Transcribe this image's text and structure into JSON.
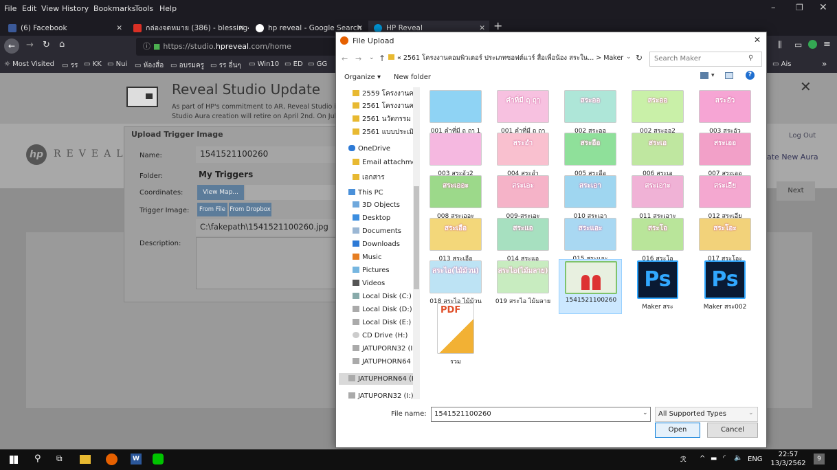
{
  "menubar": {
    "items": [
      "File",
      "Edit",
      "View",
      "History",
      "Bookmarks",
      "Tools",
      "Help"
    ]
  },
  "tabs": [
    {
      "label": "(6) Facebook"
    },
    {
      "label": "กล่องจดหมาย (386) - blessing4"
    },
    {
      "label": "hp reveal - Google Search"
    },
    {
      "label": "HP Reveal"
    }
  ],
  "url": {
    "prefix": "https://studio.",
    "host": "hpreveal",
    "suffix": ".com/home"
  },
  "bookmarks": [
    "Most Visited",
    "รร",
    "KK",
    "Nui",
    "ห้องสื่อ",
    "อบรมครู",
    "รร อื่นๆ",
    "Win10",
    "ED",
    "GG",
    "Ais"
  ],
  "banner": {
    "title": "Reveal Studio Update",
    "line1": "As part of HP's commitment to AR, Reveal Studio is b",
    "line2": "Studio Aura creation will retire on April 2nd. On July 1"
  },
  "reveal": {
    "logo": "REVEAL",
    "logout": "Log Out",
    "create": "ate New Aura",
    "next": "Next"
  },
  "trigger": {
    "title": "Upload Trigger Image",
    "name_label": "Name:",
    "name_value": "1541521100260",
    "folder_label": "Folder:",
    "folder_value": "My Triggers",
    "coords_label": "Coordinates:",
    "view_map": "View Map...",
    "image_label": "Trigger Image:",
    "from_file": "From File",
    "from_dropbox": "From Dropbox",
    "path": "C:\\fakepath\\1541521100260.jpg",
    "desc_label": "Description:"
  },
  "dialog": {
    "title": "File Upload",
    "breadcrumb": "« 2561 โครงงานคอมพิวเตอร์ ประเภทซอฟต์แวร์ สื่อเพื่อน้อง สระใน... > Maker",
    "search_placeholder": "Search Maker",
    "organize": "Organize ▾",
    "new_folder": "New folder",
    "tree": [
      "2559 โครงงานคอม",
      "2561 โครงงานคอม",
      "2561 นวัตกรรม ยร",
      "2561 แบบประเมินอ",
      "OneDrive",
      "Email attachmen",
      "เอกสาร",
      "This PC",
      "3D Objects",
      "Desktop",
      "Documents",
      "Downloads",
      "Music",
      "Pictures",
      "Videos",
      "Local Disk (C:)",
      "Local Disk (D:)",
      "Local Disk (E:)",
      "CD Drive (H:)",
      "JATUPORN32 (I:)",
      "JATUPHORN64 (",
      "JATUPHORN64 (K:",
      "JATUPORN32 (I:)"
    ],
    "files": [
      {
        "label": "001 คำที่มี ฤ ฤๅ 1",
        "text": "",
        "color": "#8fd3f4"
      },
      {
        "label": "001 คำที่มี ฤ ฤๅ",
        "text": "คำที่มี ฤ ฤๅ",
        "color": "#f7c1e0"
      },
      {
        "label": "002 สระออ",
        "text": "สระออ",
        "color": "#aee6d8"
      },
      {
        "label": "002 สระออ2",
        "text": "สระออ",
        "color": "#c9f0a8"
      },
      {
        "label": "003 สระอัว",
        "text": "สระอัว",
        "color": "#f6a5d4"
      },
      {
        "label": "003 สระอัว2",
        "text": "",
        "color": "#f5b8e0"
      },
      {
        "label": "004 สระอำ",
        "text": "สระอำ",
        "color": "#f9c0cf"
      },
      {
        "label": "005 สระอือ",
        "text": "สระอือ",
        "color": "#8fe09a"
      },
      {
        "label": "006 สระเอ",
        "text": "สระเอ",
        "color": "#bfe7a0"
      },
      {
        "label": "007 สระเออ",
        "text": "สระเออ",
        "color": "#f2a0c8"
      },
      {
        "label": "008 สระเออะ",
        "text": "สระเออะ",
        "color": "#9cd98a"
      },
      {
        "label": "009-สระเอะ",
        "text": "สระเอะ",
        "color": "#f5b3c8"
      },
      {
        "label": "010 สระเอา",
        "text": "สระเอา",
        "color": "#9fd6f0"
      },
      {
        "label": "011 สระเอาะ",
        "text": "สระเอาะ",
        "color": "#f0b2d6"
      },
      {
        "label": "012 สระเอีย",
        "text": "สระเอีย",
        "color": "#f4a8d0"
      },
      {
        "label": "013 สระเอือ",
        "text": "สระเอือ",
        "color": "#f3d77a"
      },
      {
        "label": "014 สระแอ",
        "text": "สระแอ",
        "color": "#a7e0c0"
      },
      {
        "label": "015 สระแอะ",
        "text": "สระแอะ",
        "color": "#a9d8f2"
      },
      {
        "label": "016 สระโอ",
        "text": "สระโอ",
        "color": "#b9e59a"
      },
      {
        "label": "017 สระโอะ",
        "text": "สระโอะ",
        "color": "#f2d27a"
      },
      {
        "label": "018 สระไอ ไม้ม้วน",
        "text": "สระไอ(ไม้ม้วน)",
        "color": "#bde3f4"
      },
      {
        "label": "019 สระไอ ไม้มลาย",
        "text": "สระไอ(ไม้มลาย)",
        "color": "#c8ecc0"
      },
      {
        "label": "1541521100260",
        "text": "",
        "color": "#e8f0e0"
      },
      {
        "label": "Maker สระ",
        "text": "Ps",
        "color": "#0a1a33"
      },
      {
        "label": "Maker สระ002",
        "text": "Ps",
        "color": "#0a1a33"
      },
      {
        "label": "รวม",
        "text": "PDF",
        "color": "#ffffff"
      }
    ],
    "filename_label": "File name:",
    "filename_value": "1541521100260",
    "filter": "All Supported Types",
    "open": "Open",
    "cancel": "Cancel"
  },
  "taskbar": {
    "lang": "ENG",
    "time": "22:57",
    "date": "13/3/2562",
    "notif": "9"
  }
}
